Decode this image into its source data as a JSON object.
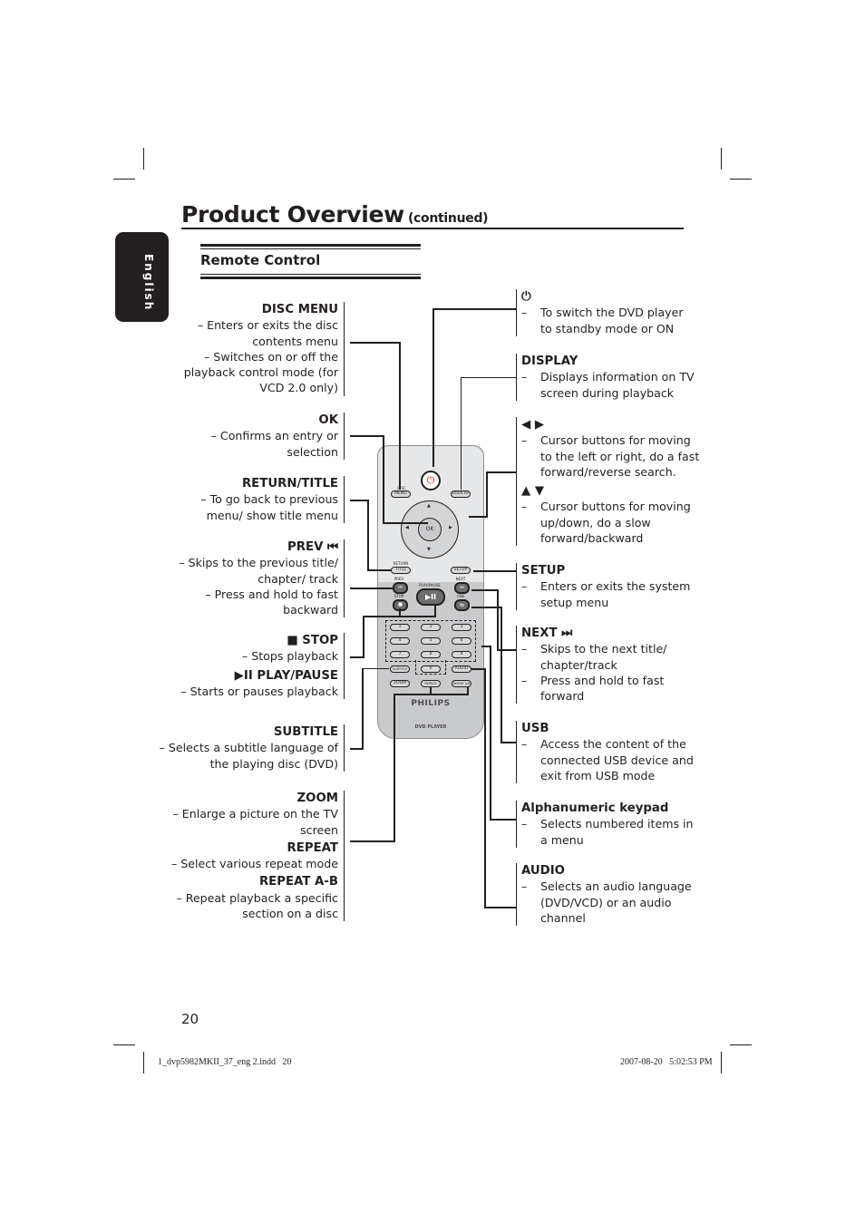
{
  "page": {
    "title": "Product Overview",
    "title_suffix": "(continued)",
    "language_tab": "English",
    "section_title": "Remote Control",
    "page_number": "20",
    "footer_file": "1_dvp5982MKII_37_eng 2.indd   20",
    "footer_timestamp": "2007-08-20   5:02:53 PM"
  },
  "left_callouts": [
    {
      "heading": "DISC MENU",
      "lines": [
        "– Enters or exits the disc",
        "contents menu",
        "– Switches on or off the",
        "playback control mode (for",
        "VCD 2.0 only)"
      ]
    },
    {
      "heading": "OK",
      "lines": [
        "– Confirms an entry or",
        "selection"
      ]
    },
    {
      "heading": "RETURN/TITLE",
      "lines": [
        "– To go back to previous",
        "menu/ show title menu"
      ]
    },
    {
      "heading": "PREV ⏮",
      "lines": [
        "– Skips to the previous title/",
        "chapter/ track",
        "– Press and hold to fast",
        "backward"
      ]
    },
    {
      "heading": "■ STOP",
      "lines": [
        "– Stops playback"
      ]
    },
    {
      "heading": "▶II PLAY/PAUSE",
      "lines": [
        "– Starts or pauses playback"
      ]
    },
    {
      "heading": "SUBTITLE",
      "lines": [
        "– Selects a subtitle language of",
        "the playing disc (DVD)"
      ]
    },
    {
      "heading": "ZOOM",
      "lines": [
        "– Enlarge a picture on the TV",
        "screen"
      ]
    },
    {
      "heading": "REPEAT",
      "lines": [
        "– Select various repeat mode"
      ]
    },
    {
      "heading": "REPEAT A-B",
      "lines": [
        "– Repeat playback a specific",
        "section on a disc"
      ]
    }
  ],
  "right_callouts": [
    {
      "heading": "⏻",
      "items": [
        [
          "To switch the DVD player",
          "to standby mode or ON"
        ]
      ]
    },
    {
      "heading": "DISPLAY",
      "items": [
        [
          "Displays information on TV",
          "screen during playback"
        ]
      ]
    },
    {
      "heading": "◀ ▶",
      "items": [
        [
          "Cursor buttons for moving",
          "to the left or right, do a fast",
          "forward/reverse search."
        ]
      ]
    },
    {
      "heading": "▲ ▼",
      "items": [
        [
          "Cursor buttons for moving",
          "up/down, do a slow",
          "forward/backward"
        ]
      ]
    },
    {
      "heading": "SETUP",
      "items": [
        [
          "Enters or exits the system",
          "setup menu"
        ]
      ]
    },
    {
      "heading": "NEXT ⏭",
      "items": [
        [
          "Skips to the next title/",
          "chapter/track"
        ],
        [
          "Press and hold to fast",
          "forward"
        ]
      ]
    },
    {
      "heading": "USB",
      "items": [
        [
          "Access the content of the",
          "connected USB device and",
          "exit from USB mode"
        ]
      ]
    },
    {
      "heading": "Alphanumeric keypad",
      "items": [
        [
          "Selects numbered items in",
          "a menu"
        ]
      ]
    },
    {
      "heading": "AUDIO",
      "items": [
        [
          "Selects an audio language",
          "(DVD/VCD) or an audio",
          "channel"
        ]
      ]
    }
  ],
  "remote": {
    "brand": "PHILIPS",
    "model_label": "DVD PLAYER",
    "power_symbol": "⏻",
    "disc_top": "DISC",
    "disc_button": "MENU",
    "display_button": "DISPLAY",
    "ok_button": "OK",
    "arrow_up": "▲",
    "arrow_down": "▼",
    "arrow_left": "◀",
    "arrow_right": "▶",
    "return_top": "RETURN",
    "title_button": "TITLE",
    "setup_button": "SETUP",
    "prev_label": "PREV",
    "prev_symbol": "⏮",
    "next_label": "NEXT",
    "next_symbol": "⏭",
    "playpause_label": "PLAY/PAUSE",
    "playpause_symbol": "▶II",
    "stop_label": "STOP",
    "stop_symbol": "■",
    "usb_label": "USB",
    "usb_symbol": "⇆",
    "keys": [
      "1",
      "2",
      "3",
      "4",
      "5",
      "6",
      "7",
      "8",
      "9",
      "0"
    ],
    "subtitle_button": "SUBTITLE",
    "audio_button": "AUDIO",
    "zoom_button": "ZOOM",
    "repeat_button": "REPEAT",
    "repeatab_button": "REPEAT A-B",
    "power_color": "#e31e24"
  }
}
